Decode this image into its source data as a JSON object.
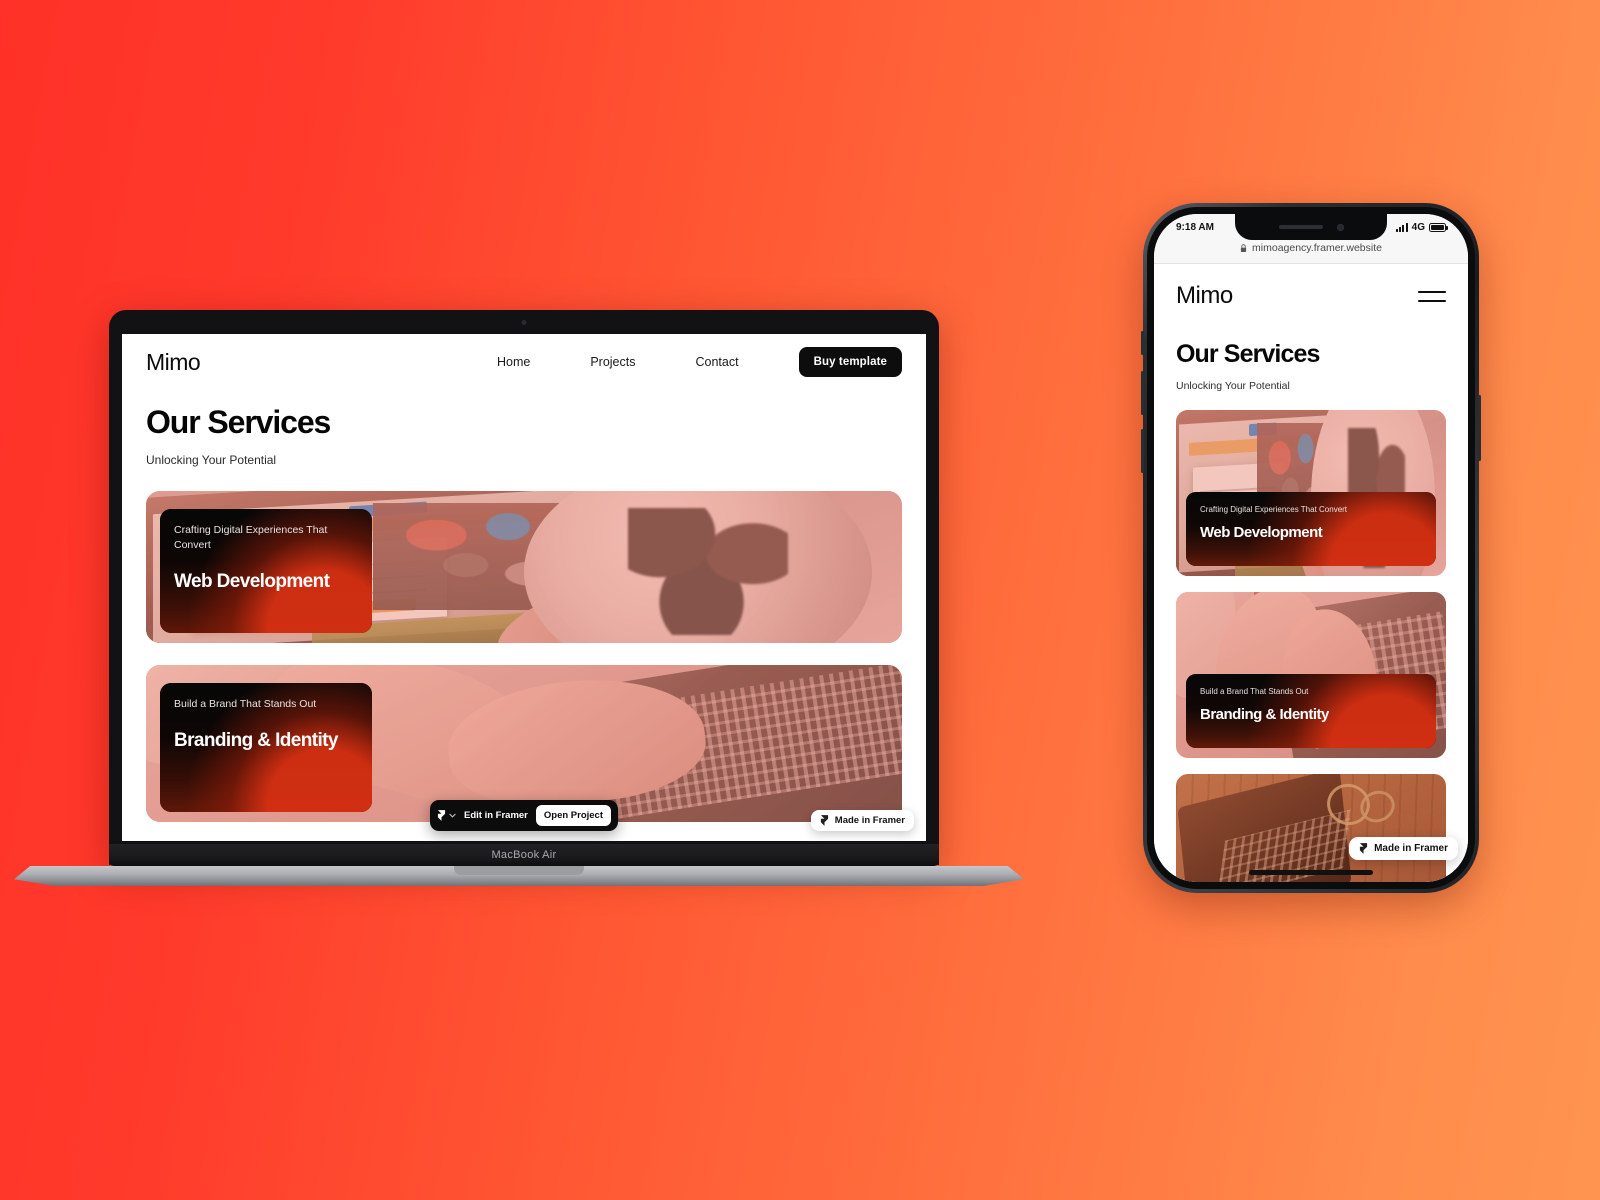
{
  "background": {
    "from": "#FF3128",
    "to": "#FF9450"
  },
  "desktop": {
    "device_label": "MacBook Air",
    "site": {
      "brand": "Mimo",
      "nav": [
        {
          "label": "Home"
        },
        {
          "label": "Projects"
        },
        {
          "label": "Contact"
        }
      ],
      "cta": "Buy template",
      "heading": "Our Services",
      "subheading": "Unlocking Your Potential",
      "cards": [
        {
          "eyebrow": "Crafting Digital Experiences That Convert",
          "title": "Web Development"
        },
        {
          "eyebrow": "Build a Brand That Stands Out",
          "title": "Branding & Identity"
        }
      ]
    },
    "framer_toolbar": {
      "edit_label": "Edit in Framer",
      "open_label": "Open Project",
      "chevron": "chevron-down-icon"
    },
    "made_badge": "Made in Framer"
  },
  "mobile": {
    "status": {
      "time": "9:18 AM",
      "network": "4G"
    },
    "url": "mimoagency.framer.website",
    "site": {
      "brand": "Mimo",
      "heading": "Our Services",
      "subheading": "Unlocking Your Potential",
      "cards": [
        {
          "eyebrow": "Crafting Digital Experiences That Convert",
          "title": "Web Development"
        },
        {
          "eyebrow": "Build a Brand That Stands Out",
          "title": "Branding & Identity"
        }
      ]
    },
    "made_badge": "Made in Framer"
  }
}
